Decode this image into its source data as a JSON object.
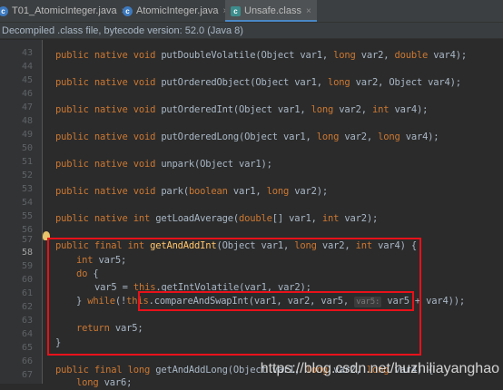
{
  "tabs": [
    {
      "label": "T01_AtomicInteger.java",
      "icon": "java-class-icon"
    },
    {
      "label": "AtomicInteger.java",
      "icon": "java-class-icon"
    },
    {
      "label": "Unsafe.class",
      "icon": "compiled-class-icon"
    }
  ],
  "close_glyph": "×",
  "banner": "Decompiled .class file, bytecode version: 52.0 (Java 8)",
  "line_numbers": {
    "n43": "43",
    "n44": "44",
    "n45": "45",
    "n46": "46",
    "n47": "47",
    "n48": "48",
    "n49": "49",
    "n50": "50",
    "n51": "51",
    "n52": "52",
    "n53": "53",
    "n54": "54",
    "n55": "55",
    "n56": "56",
    "n57": "57",
    "n58": "58",
    "n59": "59",
    "n60": "60",
    "n61": "61",
    "n62": "62",
    "n63": "63",
    "n64": "64",
    "n65": "65",
    "n66": "66",
    "n67": "67"
  },
  "code": {
    "putDoubleVolatile": {
      "kw": "public native void ",
      "name": "putDoubleVolatile",
      "args": "(Object var1, ",
      "t1": "long",
      "a2": " var2, ",
      "t2": "double",
      "a3": " var4);"
    },
    "putOrderedObject": {
      "kw": "public native void ",
      "name": "putOrderedObject",
      "args": "(Object var1, ",
      "t1": "long",
      "a2": " var2, Object var4);"
    },
    "putOrderedInt": {
      "kw": "public native void ",
      "name": "putOrderedInt",
      "args": "(Object var1, ",
      "t1": "long",
      "a2": " var2, ",
      "t2": "int",
      "a3": " var4);"
    },
    "putOrderedLong": {
      "kw": "public native void ",
      "name": "putOrderedLong",
      "args": "(Object var1, ",
      "t1": "long",
      "a2": " var2, ",
      "t2": "long",
      "a3": " var4);"
    },
    "unpark": {
      "kw": "public native void ",
      "name": "unpark",
      "args": "(Object var1);"
    },
    "park": {
      "kw": "public native void ",
      "name": "park",
      "args": "(",
      "t1": "boolean",
      "a2": " var1, ",
      "t2": "long",
      "a3": " var2);"
    },
    "getLoadAverage": {
      "kw": "public native int ",
      "name": "getLoadAverage",
      "args": "(",
      "t1": "double",
      "a2": "[] var1, ",
      "t2": "int",
      "a3": " var2);"
    },
    "getAndAddInt": {
      "kw": "public final int ",
      "name": "getAndAddInt",
      "args": "(Object var1, ",
      "t1": "long",
      "a2": " var2, ",
      "t2": "int",
      "a3": " var4) {"
    },
    "body1": {
      "t": "int",
      "rest": " var5;"
    },
    "body2": {
      "t": "do",
      "rest": " {"
    },
    "body3": {
      "pre": "var5 = ",
      "t": "this",
      "rest": ".getIntVolatile(var1, var2);"
    },
    "body4": {
      "pre": "} ",
      "t": "while",
      "mid": "(!",
      "t2": "this",
      "call": ".compareAndSwapInt(var1, var2, var5, ",
      "hint": "var5:",
      "rest": " var5 + var4));"
    },
    "body5": {
      "t": "return",
      "rest": " var5;"
    },
    "body6": {
      "rest": "}"
    },
    "getAndAddLong": {
      "kw": "public final long ",
      "name": "getAndAddLong",
      "args": "(Object var1, ",
      "t1": "long",
      "a2": " var2, ",
      "t2": "long",
      "a3": " var4) {"
    },
    "body7": {
      "t": "long",
      "rest": " var6;"
    }
  },
  "watermark": "https://blog.csdn.net/huzhiliayanghao",
  "colors": {
    "keyword": "#cc7832",
    "method": "#ffc66d",
    "text": "#a9b7c6",
    "highlight_box": "#e8111a"
  }
}
